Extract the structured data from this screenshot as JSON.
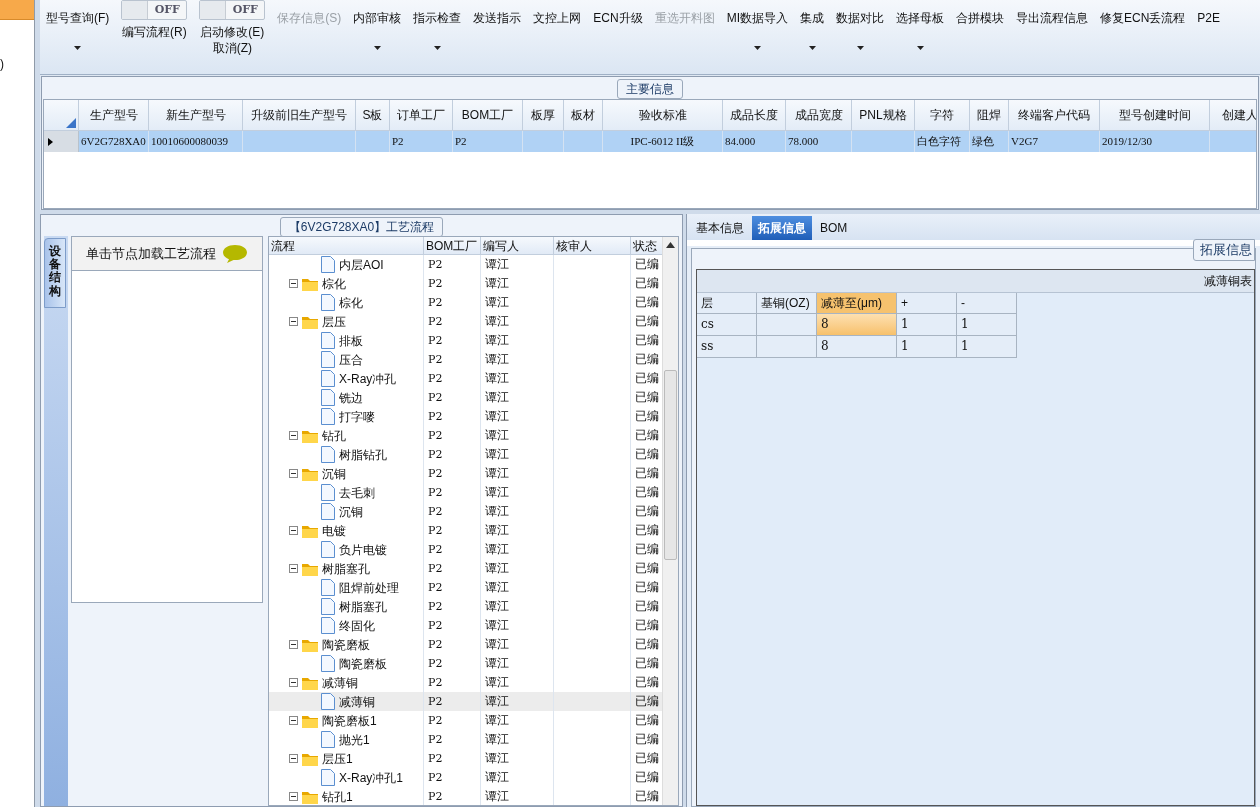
{
  "left_strip": {
    "text": ")"
  },
  "toolbar": [
    {
      "kind": "button",
      "lines": [
        "型号查询(F)"
      ],
      "dropdown": true,
      "disabled": false
    },
    {
      "kind": "toggle",
      "switch_text": "OFF",
      "on": false,
      "lines": [
        "编写流程(R)"
      ]
    },
    {
      "kind": "toggle",
      "switch_text": "OFF",
      "on": false,
      "lines": [
        "启动修改(E)",
        "取消(Z)"
      ]
    },
    {
      "kind": "button",
      "lines": [
        "保存信息(S)"
      ],
      "dropdown": false,
      "disabled": true
    },
    {
      "kind": "button",
      "lines": [
        "内部审核"
      ],
      "dropdown": true,
      "disabled": false
    },
    {
      "kind": "button",
      "lines": [
        "指示检查"
      ],
      "dropdown": true,
      "disabled": false
    },
    {
      "kind": "button",
      "lines": [
        "发送指示"
      ],
      "dropdown": false,
      "disabled": false
    },
    {
      "kind": "button",
      "lines": [
        "文控上网"
      ],
      "dropdown": false,
      "disabled": false
    },
    {
      "kind": "button",
      "lines": [
        "ECN升级"
      ],
      "dropdown": false,
      "disabled": false
    },
    {
      "kind": "button",
      "lines": [
        "重选开料图"
      ],
      "dropdown": false,
      "disabled": true
    },
    {
      "kind": "button",
      "lines": [
        "MI数据导入"
      ],
      "dropdown": true,
      "disabled": false
    },
    {
      "kind": "button",
      "lines": [
        "集成"
      ],
      "dropdown": true,
      "disabled": false
    },
    {
      "kind": "button",
      "lines": [
        "数据对比"
      ],
      "dropdown": true,
      "disabled": false
    },
    {
      "kind": "button",
      "lines": [
        "选择母板"
      ],
      "dropdown": true,
      "disabled": false
    },
    {
      "kind": "button",
      "lines": [
        "合拼模块"
      ],
      "dropdown": false,
      "disabled": false
    },
    {
      "kind": "button",
      "lines": [
        "导出流程信息"
      ],
      "dropdown": false,
      "disabled": false
    },
    {
      "kind": "button",
      "lines": [
        "修复ECN丢流程"
      ],
      "dropdown": false,
      "disabled": false
    },
    {
      "kind": "button",
      "lines": [
        "P2E"
      ],
      "dropdown": false,
      "disabled": false
    }
  ],
  "main_info": {
    "title": "主要信息",
    "columns": [
      "生产型号",
      "新生产型号",
      "升级前旧生产型号",
      "S板",
      "订单工厂",
      "BOM工厂",
      "板厚",
      "板材",
      "验收标准",
      "成品长度",
      "成品宽度",
      "PNL规格",
      "字符",
      "阻焊",
      "终端客户代码",
      "型号创建时间",
      "创建人"
    ],
    "rows": [
      {
        "selected": true,
        "cells": [
          "6V2G728XA0",
          "10010600080039",
          "",
          "",
          "P2",
          "P2",
          "",
          "",
          "IPC-6012 II级",
          "84.000",
          "78.000",
          "",
          "白色字符",
          "绿色",
          "V2G7",
          "2019/12/30",
          ""
        ]
      }
    ]
  },
  "process": {
    "title": "【6V2G728XA0】工艺流程",
    "side_tab": "设备结构",
    "hint": "单击节点加载工艺流程",
    "columns": [
      "流程",
      "BOM工厂",
      "编写人",
      "核审人",
      "状态"
    ],
    "tree": [
      {
        "kind": "file",
        "label": "内层AOI",
        "bom": "P2",
        "writer": "谭江",
        "status": "已编",
        "selected": false
      },
      {
        "kind": "folder",
        "label": "棕化",
        "bom": "P2",
        "writer": "谭江",
        "status": "已编",
        "selected": false,
        "expanded": true,
        "children": [
          {
            "kind": "file",
            "label": "棕化",
            "bom": "P2",
            "writer": "谭江",
            "status": "已编",
            "selected": false
          }
        ]
      },
      {
        "kind": "folder",
        "label": "层压",
        "bom": "P2",
        "writer": "谭江",
        "status": "已编",
        "selected": false,
        "expanded": true,
        "children": [
          {
            "kind": "file",
            "label": "排板",
            "bom": "P2",
            "writer": "谭江",
            "status": "已编",
            "selected": false
          },
          {
            "kind": "file",
            "label": "压合",
            "bom": "P2",
            "writer": "谭江",
            "status": "已编",
            "selected": false
          },
          {
            "kind": "file",
            "label": "X-Ray冲孔",
            "bom": "P2",
            "writer": "谭江",
            "status": "已编",
            "selected": false
          },
          {
            "kind": "file",
            "label": "铣边",
            "bom": "P2",
            "writer": "谭江",
            "status": "已编",
            "selected": false
          },
          {
            "kind": "file",
            "label": "打字嘜",
            "bom": "P2",
            "writer": "谭江",
            "status": "已编",
            "selected": false
          }
        ]
      },
      {
        "kind": "folder",
        "label": "钻孔",
        "bom": "P2",
        "writer": "谭江",
        "status": "已编",
        "selected": false,
        "expanded": true,
        "children": [
          {
            "kind": "file",
            "label": "树脂钻孔",
            "bom": "P2",
            "writer": "谭江",
            "status": "已编",
            "selected": false
          }
        ]
      },
      {
        "kind": "folder",
        "label": "沉铜",
        "bom": "P2",
        "writer": "谭江",
        "status": "已编",
        "selected": false,
        "expanded": true,
        "children": [
          {
            "kind": "file",
            "label": "去毛刺",
            "bom": "P2",
            "writer": "谭江",
            "status": "已编",
            "selected": false
          },
          {
            "kind": "file",
            "label": "沉铜",
            "bom": "P2",
            "writer": "谭江",
            "status": "已编",
            "selected": false
          }
        ]
      },
      {
        "kind": "folder",
        "label": "电镀",
        "bom": "P2",
        "writer": "谭江",
        "status": "已编",
        "selected": false,
        "expanded": true,
        "children": [
          {
            "kind": "file",
            "label": "负片电镀",
            "bom": "P2",
            "writer": "谭江",
            "status": "已编",
            "selected": false
          }
        ]
      },
      {
        "kind": "folder",
        "label": "树脂塞孔",
        "bom": "P2",
        "writer": "谭江",
        "status": "已编",
        "selected": false,
        "expanded": true,
        "children": [
          {
            "kind": "file",
            "label": "阻焊前处理",
            "bom": "P2",
            "writer": "谭江",
            "status": "已编",
            "selected": false
          },
          {
            "kind": "file",
            "label": "树脂塞孔",
            "bom": "P2",
            "writer": "谭江",
            "status": "已编",
            "selected": false
          },
          {
            "kind": "file",
            "label": "终固化",
            "bom": "P2",
            "writer": "谭江",
            "status": "已编",
            "selected": false
          }
        ]
      },
      {
        "kind": "folder",
        "label": "陶瓷磨板",
        "bom": "P2",
        "writer": "谭江",
        "status": "已编",
        "selected": false,
        "expanded": true,
        "children": [
          {
            "kind": "file",
            "label": "陶瓷磨板",
            "bom": "P2",
            "writer": "谭江",
            "status": "已编",
            "selected": false
          }
        ]
      },
      {
        "kind": "folder",
        "label": "减薄铜",
        "bom": "P2",
        "writer": "谭江",
        "status": "已编",
        "selected": false,
        "expanded": true,
        "children": [
          {
            "kind": "file",
            "label": "减薄铜",
            "bom": "P2",
            "writer": "谭江",
            "status": "已编",
            "selected": true
          }
        ]
      },
      {
        "kind": "folder",
        "label": "陶瓷磨板1",
        "bom": "P2",
        "writer": "谭江",
        "status": "已编",
        "selected": false,
        "expanded": true,
        "children": [
          {
            "kind": "file",
            "label": "抛光1",
            "bom": "P2",
            "writer": "谭江",
            "status": "已编",
            "selected": false
          }
        ]
      },
      {
        "kind": "folder",
        "label": "层压1",
        "bom": "P2",
        "writer": "谭江",
        "status": "已编",
        "selected": false,
        "expanded": true,
        "children": [
          {
            "kind": "file",
            "label": "X-Ray冲孔1",
            "bom": "P2",
            "writer": "谭江",
            "status": "已编",
            "selected": false
          }
        ]
      },
      {
        "kind": "folder",
        "label": "钻孔1",
        "bom": "P2",
        "writer": "谭江",
        "status": "已编",
        "selected": false,
        "expanded": true
      }
    ]
  },
  "detail": {
    "tabs": [
      {
        "label": "基本信息",
        "selected": false
      },
      {
        "label": "拓展信息",
        "selected": true
      },
      {
        "label": "BOM",
        "selected": false
      }
    ],
    "group_title": "拓展信息",
    "table_title": "减薄铜表",
    "columns": [
      {
        "label": "层",
        "highlighted": false
      },
      {
        "label": "基铜(OZ)",
        "highlighted": false
      },
      {
        "label": "减薄至(μm)",
        "highlighted": true
      },
      {
        "label": "+",
        "highlighted": false
      },
      {
        "label": "-",
        "highlighted": false
      }
    ],
    "rows": [
      {
        "cells": [
          "cs",
          "",
          "8",
          "1",
          "1"
        ],
        "selected": true
      },
      {
        "cells": [
          "ss",
          "",
          "8",
          "1",
          "1"
        ],
        "selected": false
      }
    ]
  }
}
